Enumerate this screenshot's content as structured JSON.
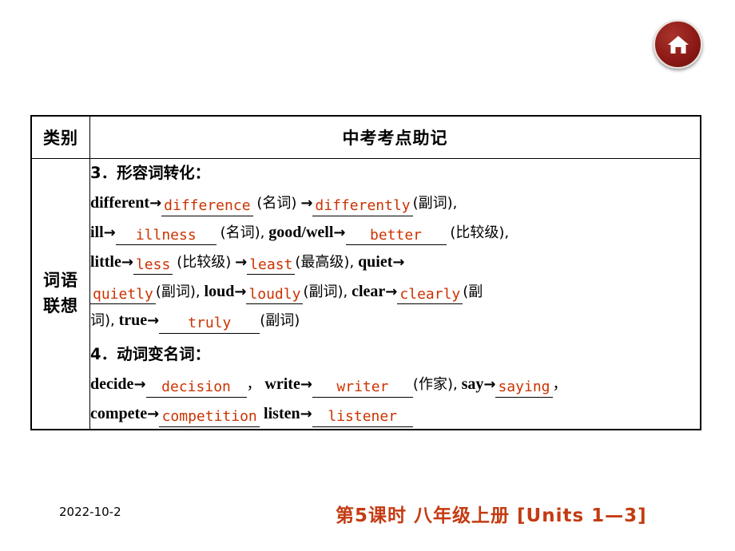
{
  "home_button": {
    "icon": "home-icon",
    "color": "#8d1a16"
  },
  "table": {
    "header": {
      "category": "类别",
      "main": "中考考点助记"
    },
    "row": {
      "category_line1": "词语",
      "category_line2": "联想",
      "sections": [
        {
          "number": "3．",
          "heading": "形容词转化："
        },
        {
          "number": "4．",
          "heading": "动词变名词："
        }
      ],
      "items_adj": [
        {
          "base": "different",
          "answer": "difference",
          "note": "(名词)"
        },
        {
          "base": "",
          "answer": "differently",
          "note": "(副词),"
        },
        {
          "base": "ill",
          "answer": "illness",
          "note": "(名词),"
        },
        {
          "base": "good/well",
          "answer": "better",
          "note": "(比较级),"
        },
        {
          "base": "little",
          "answer": "less",
          "note": "(比较级)"
        },
        {
          "base": "",
          "answer": "least",
          "note": "(最高级),"
        },
        {
          "base": "quiet",
          "answer": "quietly",
          "note": "(副词),"
        },
        {
          "base": "loud",
          "answer": "loudly",
          "note": "(副词),"
        },
        {
          "base": "clear",
          "answer": "clearly",
          "note": "(副词),"
        },
        {
          "base": "true",
          "answer": "truly",
          "note": "(副词)"
        }
      ],
      "items_verb": [
        {
          "base": "decide",
          "answer": "decision",
          "note": "，"
        },
        {
          "base": "write",
          "answer": "writer",
          "note": "(作家),"
        },
        {
          "base": "say",
          "answer": "saying",
          "note": "，"
        },
        {
          "base": "compete",
          "answer": "competition",
          "note": ""
        },
        {
          "base": "listen",
          "answer": "listener",
          "note": ""
        }
      ]
    }
  },
  "footer": {
    "date": "2022-10-2",
    "title": "第5课时  八年级上册 [Units 1—3]"
  }
}
